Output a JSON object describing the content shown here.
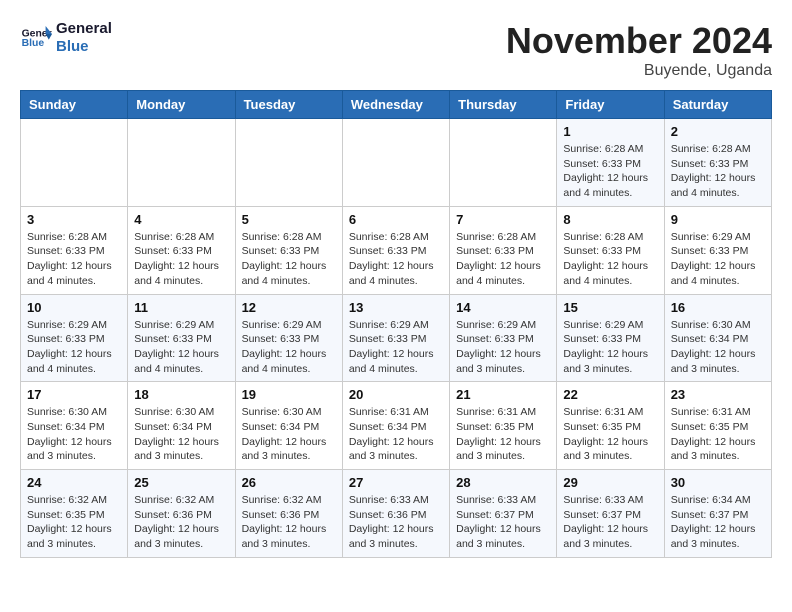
{
  "header": {
    "logo_line1": "General",
    "logo_line2": "Blue",
    "month": "November 2024",
    "location": "Buyende, Uganda"
  },
  "days_of_week": [
    "Sunday",
    "Monday",
    "Tuesday",
    "Wednesday",
    "Thursday",
    "Friday",
    "Saturday"
  ],
  "weeks": [
    [
      {
        "day": "",
        "content": ""
      },
      {
        "day": "",
        "content": ""
      },
      {
        "day": "",
        "content": ""
      },
      {
        "day": "",
        "content": ""
      },
      {
        "day": "",
        "content": ""
      },
      {
        "day": "1",
        "content": "Sunrise: 6:28 AM\nSunset: 6:33 PM\nDaylight: 12 hours and 4 minutes."
      },
      {
        "day": "2",
        "content": "Sunrise: 6:28 AM\nSunset: 6:33 PM\nDaylight: 12 hours and 4 minutes."
      }
    ],
    [
      {
        "day": "3",
        "content": "Sunrise: 6:28 AM\nSunset: 6:33 PM\nDaylight: 12 hours and 4 minutes."
      },
      {
        "day": "4",
        "content": "Sunrise: 6:28 AM\nSunset: 6:33 PM\nDaylight: 12 hours and 4 minutes."
      },
      {
        "day": "5",
        "content": "Sunrise: 6:28 AM\nSunset: 6:33 PM\nDaylight: 12 hours and 4 minutes."
      },
      {
        "day": "6",
        "content": "Sunrise: 6:28 AM\nSunset: 6:33 PM\nDaylight: 12 hours and 4 minutes."
      },
      {
        "day": "7",
        "content": "Sunrise: 6:28 AM\nSunset: 6:33 PM\nDaylight: 12 hours and 4 minutes."
      },
      {
        "day": "8",
        "content": "Sunrise: 6:28 AM\nSunset: 6:33 PM\nDaylight: 12 hours and 4 minutes."
      },
      {
        "day": "9",
        "content": "Sunrise: 6:29 AM\nSunset: 6:33 PM\nDaylight: 12 hours and 4 minutes."
      }
    ],
    [
      {
        "day": "10",
        "content": "Sunrise: 6:29 AM\nSunset: 6:33 PM\nDaylight: 12 hours and 4 minutes."
      },
      {
        "day": "11",
        "content": "Sunrise: 6:29 AM\nSunset: 6:33 PM\nDaylight: 12 hours and 4 minutes."
      },
      {
        "day": "12",
        "content": "Sunrise: 6:29 AM\nSunset: 6:33 PM\nDaylight: 12 hours and 4 minutes."
      },
      {
        "day": "13",
        "content": "Sunrise: 6:29 AM\nSunset: 6:33 PM\nDaylight: 12 hours and 4 minutes."
      },
      {
        "day": "14",
        "content": "Sunrise: 6:29 AM\nSunset: 6:33 PM\nDaylight: 12 hours and 3 minutes."
      },
      {
        "day": "15",
        "content": "Sunrise: 6:29 AM\nSunset: 6:33 PM\nDaylight: 12 hours and 3 minutes."
      },
      {
        "day": "16",
        "content": "Sunrise: 6:30 AM\nSunset: 6:34 PM\nDaylight: 12 hours and 3 minutes."
      }
    ],
    [
      {
        "day": "17",
        "content": "Sunrise: 6:30 AM\nSunset: 6:34 PM\nDaylight: 12 hours and 3 minutes."
      },
      {
        "day": "18",
        "content": "Sunrise: 6:30 AM\nSunset: 6:34 PM\nDaylight: 12 hours and 3 minutes."
      },
      {
        "day": "19",
        "content": "Sunrise: 6:30 AM\nSunset: 6:34 PM\nDaylight: 12 hours and 3 minutes."
      },
      {
        "day": "20",
        "content": "Sunrise: 6:31 AM\nSunset: 6:34 PM\nDaylight: 12 hours and 3 minutes."
      },
      {
        "day": "21",
        "content": "Sunrise: 6:31 AM\nSunset: 6:35 PM\nDaylight: 12 hours and 3 minutes."
      },
      {
        "day": "22",
        "content": "Sunrise: 6:31 AM\nSunset: 6:35 PM\nDaylight: 12 hours and 3 minutes."
      },
      {
        "day": "23",
        "content": "Sunrise: 6:31 AM\nSunset: 6:35 PM\nDaylight: 12 hours and 3 minutes."
      }
    ],
    [
      {
        "day": "24",
        "content": "Sunrise: 6:32 AM\nSunset: 6:35 PM\nDaylight: 12 hours and 3 minutes."
      },
      {
        "day": "25",
        "content": "Sunrise: 6:32 AM\nSunset: 6:36 PM\nDaylight: 12 hours and 3 minutes."
      },
      {
        "day": "26",
        "content": "Sunrise: 6:32 AM\nSunset: 6:36 PM\nDaylight: 12 hours and 3 minutes."
      },
      {
        "day": "27",
        "content": "Sunrise: 6:33 AM\nSunset: 6:36 PM\nDaylight: 12 hours and 3 minutes."
      },
      {
        "day": "28",
        "content": "Sunrise: 6:33 AM\nSunset: 6:37 PM\nDaylight: 12 hours and 3 minutes."
      },
      {
        "day": "29",
        "content": "Sunrise: 6:33 AM\nSunset: 6:37 PM\nDaylight: 12 hours and 3 minutes."
      },
      {
        "day": "30",
        "content": "Sunrise: 6:34 AM\nSunset: 6:37 PM\nDaylight: 12 hours and 3 minutes."
      }
    ]
  ]
}
